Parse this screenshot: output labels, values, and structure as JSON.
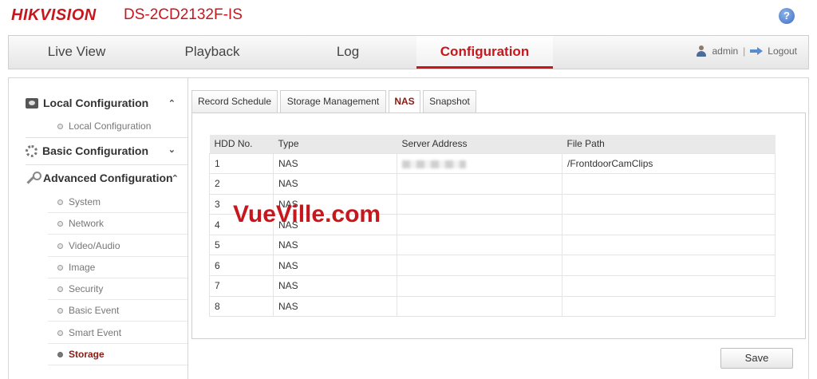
{
  "header": {
    "logo": "HIKVISION",
    "model": "DS-2CD2132F-IS",
    "help_icon": "?"
  },
  "nav": {
    "tabs": [
      "Live View",
      "Playback",
      "Log",
      "Configuration"
    ],
    "active": "Configuration",
    "user": "admin",
    "separator": "|",
    "logout": "Logout"
  },
  "sidebar": {
    "local": {
      "title": "Local Configuration",
      "items": [
        "Local Configuration"
      ]
    },
    "basic": {
      "title": "Basic Configuration"
    },
    "advanced": {
      "title": "Advanced Configuration",
      "items": [
        "System",
        "Network",
        "Video/Audio",
        "Image",
        "Security",
        "Basic Event",
        "Smart Event",
        "Storage"
      ],
      "active": "Storage"
    }
  },
  "subtabs": [
    "Record Schedule",
    "Storage Management",
    "NAS",
    "Snapshot"
  ],
  "active_subtab": "NAS",
  "table": {
    "headers": [
      "HDD No.",
      "Type",
      "Server Address",
      "File Path"
    ],
    "rows": [
      {
        "no": "1",
        "type": "NAS",
        "path": "/FrontdoorCamClips"
      },
      {
        "no": "2",
        "type": "NAS",
        "path": ""
      },
      {
        "no": "3",
        "type": "NAS",
        "path": ""
      },
      {
        "no": "4",
        "type": "NAS",
        "path": ""
      },
      {
        "no": "5",
        "type": "NAS",
        "path": ""
      },
      {
        "no": "6",
        "type": "NAS",
        "path": ""
      },
      {
        "no": "7",
        "type": "NAS",
        "path": ""
      },
      {
        "no": "8",
        "type": "NAS",
        "path": ""
      }
    ]
  },
  "watermark": "VueVille.com",
  "save_label": "Save",
  "colors": {
    "brand": "#c8161d",
    "active_menu": "#8a1a14"
  }
}
